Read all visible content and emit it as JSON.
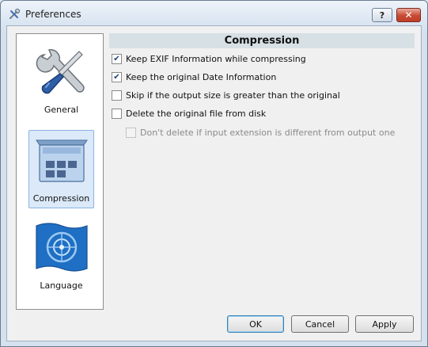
{
  "window": {
    "title": "Preferences",
    "help_label": "?",
    "close_label": "✕",
    "app_icon": "tools-icon"
  },
  "sidebar": {
    "items": [
      {
        "label": "General",
        "icon": "tools-wrench-screwdriver-icon",
        "selected": false
      },
      {
        "label": "Compression",
        "icon": "compression-box-icon",
        "selected": true
      },
      {
        "label": "Language",
        "icon": "language-globe-flag-icon",
        "selected": false
      }
    ]
  },
  "section": {
    "title": "Compression",
    "options": [
      {
        "label": "Keep EXIF Information while compressing",
        "checked": true,
        "enabled": true
      },
      {
        "label": "Keep the original Date Information",
        "checked": true,
        "enabled": true
      },
      {
        "label": "Skip if the output size is greater than the original",
        "checked": false,
        "enabled": true
      },
      {
        "label": "Delete the original file from disk",
        "checked": false,
        "enabled": true
      },
      {
        "label": "Don't delete if input extension is different from output one",
        "checked": false,
        "enabled": false
      }
    ]
  },
  "buttons": {
    "ok": "OK",
    "cancel": "Cancel",
    "apply": "Apply"
  },
  "colors": {
    "selection_bg": "#dbe9f9",
    "header_bg": "#d6e0e5",
    "close_red": "#c84a33"
  }
}
